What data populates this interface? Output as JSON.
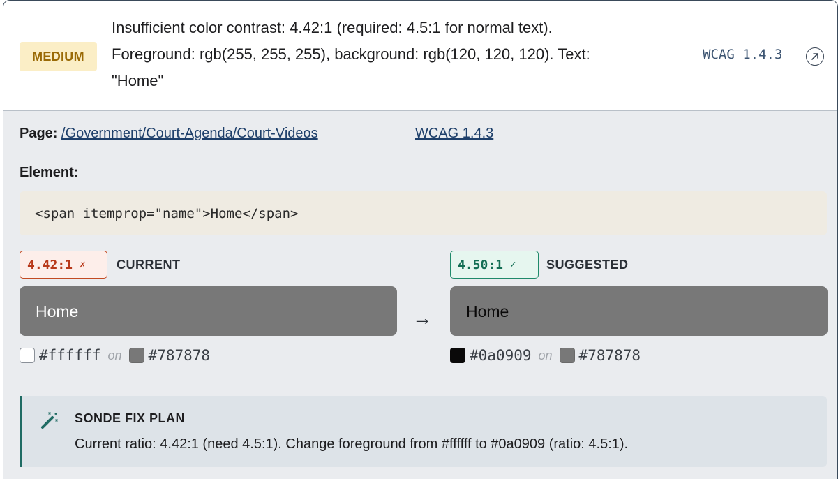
{
  "issue": {
    "severity": "MEDIUM",
    "message_lines": [
      "Insufficient color contrast: 4.42:1 (required: 4.5:1 for normal text).",
      "Foreground: rgb(255, 255, 255), background: rgb(120, 120, 120). Text:",
      "\"Home\""
    ],
    "wcag_ref": "WCAG 1.4.3",
    "external_icon": "external-link-icon"
  },
  "details": {
    "page_label": "Page:",
    "page_path": "/Government/Court-Agenda/Court-Videos",
    "wcag_link": "WCAG 1.4.3",
    "element_label": "Element:",
    "element_code": "<span itemprop=\"name\">Home</span>"
  },
  "current": {
    "ratio": "4.42:1",
    "mark": "✗",
    "label": "CURRENT",
    "preview_text": "Home",
    "foreground": "#ffffff",
    "on": "on",
    "background": "#787878"
  },
  "suggested": {
    "ratio": "4.50:1",
    "mark": "✓",
    "label": "SUGGESTED",
    "preview_text": "Home",
    "foreground": "#0a0909",
    "on": "on",
    "background": "#787878"
  },
  "arrow": "→",
  "fix_plan": {
    "icon": "magic-wand-icon",
    "title": "SONDE FIX PLAN",
    "text": "Current ratio: 4.42:1 (need 4.5:1). Change foreground from #ffffff to #0a0909 (ratio: 4.5:1)."
  },
  "colors": {
    "severity_bg": "#fbeec6",
    "severity_fg": "#9a6a06",
    "bad": "#b8391a",
    "good": "#136e54",
    "accent": "#1f6b63"
  }
}
